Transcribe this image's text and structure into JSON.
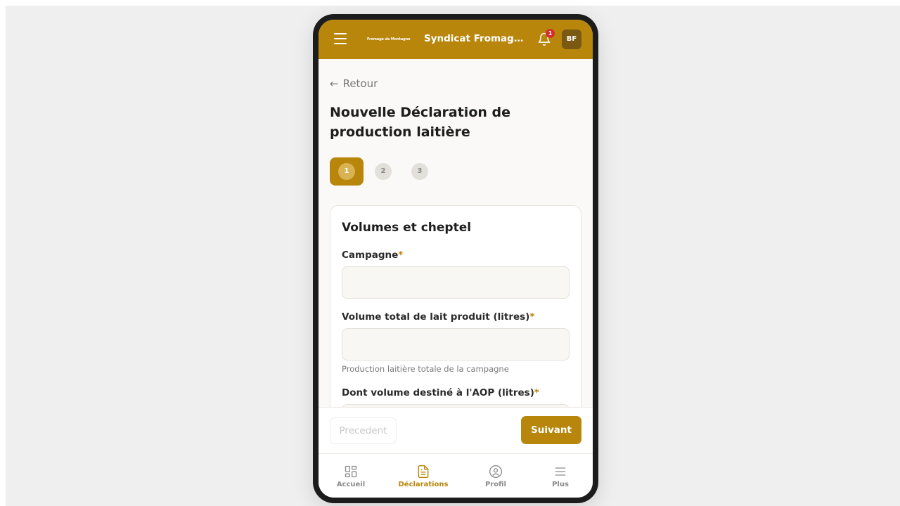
{
  "header": {
    "brand_small": "Fromage de Montagne",
    "org_title": "Syndicat Fromager ...",
    "notification_count": "1",
    "avatar_initials": "BF"
  },
  "nav": {
    "back_label": "Retour"
  },
  "page": {
    "title": "Nouvelle Déclaration de production laitière"
  },
  "stepper": {
    "steps": [
      "1",
      "2",
      "3"
    ],
    "current": 1
  },
  "form": {
    "section_title": "Volumes et cheptel",
    "fields": [
      {
        "label": "Campagne",
        "required_mark": "*",
        "value": "",
        "help": ""
      },
      {
        "label": "Volume total de lait produit (litres)",
        "required_mark": "*",
        "value": "",
        "help": "Production laitière totale de la campagne"
      },
      {
        "label": "Dont volume destiné à l'AOP (litres)",
        "required_mark": "*",
        "value": "",
        "help": ""
      }
    ]
  },
  "actions": {
    "prev_label": "Precedent",
    "next_label": "Suivant"
  },
  "bottom_nav": {
    "items": [
      {
        "label": "Accueil",
        "icon": "dashboard-icon"
      },
      {
        "label": "Déclarations",
        "icon": "document-icon",
        "active": true
      },
      {
        "label": "Profil",
        "icon": "user-circle-icon"
      },
      {
        "label": "Plus",
        "icon": "menu-icon"
      }
    ]
  },
  "colors": {
    "brand": "#b8860b",
    "badge": "#d32f2f",
    "avatar_bg": "#7a5a12"
  }
}
